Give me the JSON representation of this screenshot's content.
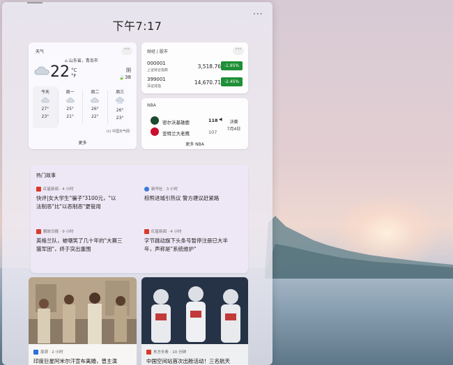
{
  "panel": {
    "time": "下午7:17",
    "more_label": "···"
  },
  "weather": {
    "title": "天气",
    "location": "山东省，青岛市",
    "temperature": "22",
    "unit_c": "°C",
    "unit_f": "°F",
    "condition": "阴",
    "aqi": "38",
    "days": [
      {
        "label": "今天",
        "icon": "cloud-icon",
        "high": "27°",
        "low": "23°"
      },
      {
        "label": "周一",
        "icon": "cloud-icon",
        "high": "25°",
        "low": "21°"
      },
      {
        "label": "周二",
        "icon": "cloud-icon",
        "high": "26°",
        "low": "22°"
      },
      {
        "label": "周三",
        "icon": "rain-cloud-icon",
        "high": "26°",
        "low": "23°"
      }
    ],
    "source": "(c) 中国天气网",
    "more_label": "更多"
  },
  "finance": {
    "title": "财经 | 股市",
    "stocks": [
      {
        "code": "000001",
        "name": "上证综合指数",
        "price": "3,518.76",
        "change": "-1.95%"
      },
      {
        "code": "399001",
        "name": "深证成指",
        "price": "14,670.71",
        "change": "-2.45%"
      }
    ],
    "change_color": "#1e8f36"
  },
  "nba": {
    "title": "NBA",
    "teams": [
      {
        "name": "密尔沃基雄鹿",
        "score": "118",
        "color": "#1b4a2c"
      },
      {
        "name": "亚特兰大老鹰",
        "score": "107",
        "color": "#c8102e"
      }
    ],
    "status": "决赛",
    "date": "7月4日",
    "more_label": "更多 NBA"
  },
  "trending": {
    "title": "热门故事",
    "stories": [
      {
        "source": "红星新闻 · 4 小时",
        "source_color": "#d83a2a",
        "headline_1": "快评|女大学生\"骗子\"3100元，\"以",
        "headline_2": "法制恶\"比\"以恶制恶\"更管用"
      },
      {
        "source": "新华社 · 3 小时",
        "source_color": "#3a7bd5",
        "headline_1": "棕熊进城引热议 警方建议赶紧路",
        "headline_2": ""
      },
      {
        "source": "解放日报 · 9 小时",
        "source_color": "#d83a2a",
        "headline_1": "英格兰队，被嘲笑了几十年的\"大赛三",
        "headline_2": "猫军团\"，终于突出重围"
      },
      {
        "source": "红星新闻 · 4 小时",
        "source_color": "#d83a2a",
        "headline_1": "字节跳动旗下头条号暂停注册已大半",
        "headline_2": "年，声称是\"系统维护\""
      }
    ]
  },
  "image_cards": [
    {
      "source": "澎湃 · 2 小时",
      "source_color": "#2a6fdb",
      "headline": "印度巨星阿米尔汗宣布离婚，曾主演"
    },
    {
      "source": "东方头条 · 10 分钟",
      "source_color": "#d83a2a",
      "headline": "中国空间站首次出舱活动！三名航天"
    }
  ]
}
